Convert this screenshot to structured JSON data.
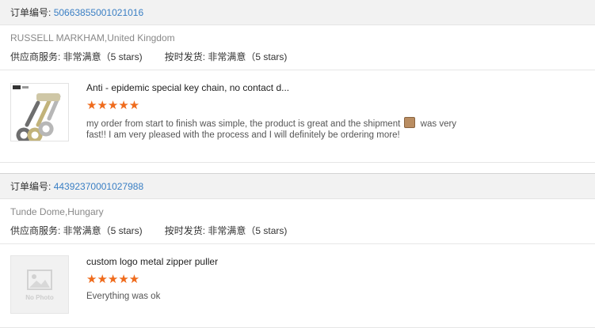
{
  "orders": [
    {
      "order_label": "订单编号:",
      "order_no": "50663855001021016",
      "buyer": "RUSSELL MARKHAM,United Kingdom",
      "supplier_service": "供应商服务: 非常满意（5 stars)",
      "on_time": "按时发货: 非常满意（5 stars)",
      "item_title": "Anti - epidemic special key chain, no contact d...",
      "stars": "★★★★★",
      "rating": 5,
      "review_part1": "my order from start to finish was simple, the product is great and the shipment ",
      "review_part2": " was very fast!! I am very pleased with the process and I will definitely be ordering more!",
      "thumb_icon": "metal-key-tool-product-icon"
    },
    {
      "order_label": "订单编号:",
      "order_no": "44392370001027988",
      "buyer": "Tunde Dome,Hungary",
      "supplier_service": "供应商服务: 非常满意（5 stars)",
      "on_time": "按时发货: 非常满意（5 stars)",
      "item_title": "custom logo metal zipper puller",
      "stars": "★★★★★",
      "rating": 5,
      "review": "Everything was ok",
      "thumb_label": "No Photo",
      "thumb_icon": "image-placeholder-icon"
    }
  ],
  "colors": {
    "accent_link": "#3a7fc4",
    "star": "#ef6b1c",
    "header_bg": "#f2f2f2"
  }
}
